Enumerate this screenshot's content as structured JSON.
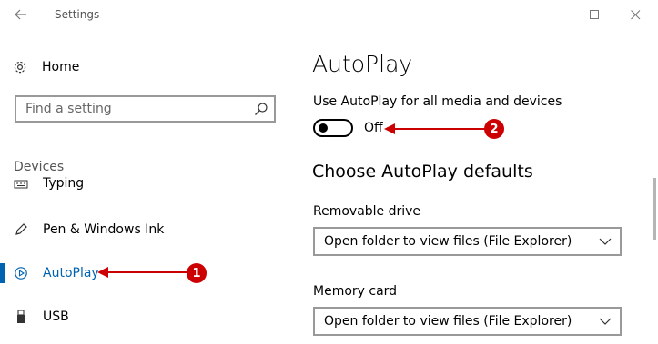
{
  "window": {
    "title": "Settings",
    "controls": [
      "minimize",
      "maximize",
      "close"
    ]
  },
  "nav": {
    "home_label": "Home",
    "search_placeholder": "Find a setting",
    "section_label": "Devices",
    "items": [
      {
        "label": "Typing",
        "icon": "keyboard-icon"
      },
      {
        "label": "Pen & Windows Ink",
        "icon": "pen-icon"
      },
      {
        "label": "AutoPlay",
        "icon": "autoplay-icon",
        "selected": true
      },
      {
        "label": "USB",
        "icon": "usb-icon"
      }
    ]
  },
  "main": {
    "title": "AutoPlay",
    "toggle_caption": "Use AutoPlay for all media and devices",
    "toggle_state": "Off",
    "toggle_on": false,
    "section_title": "Choose AutoPlay defaults",
    "removable_label": "Removable drive",
    "removable_value": "Open folder to view files (File Explorer)",
    "memory_label": "Memory card",
    "memory_value": "Open folder to view files (File Explorer)"
  },
  "annotations": [
    {
      "number": "1",
      "target": "AutoPlay nav item"
    },
    {
      "number": "2",
      "target": "AutoPlay toggle state"
    }
  ],
  "colors": {
    "accent": "#0063b1",
    "annotation": "#cc0000",
    "border": "#999999"
  }
}
